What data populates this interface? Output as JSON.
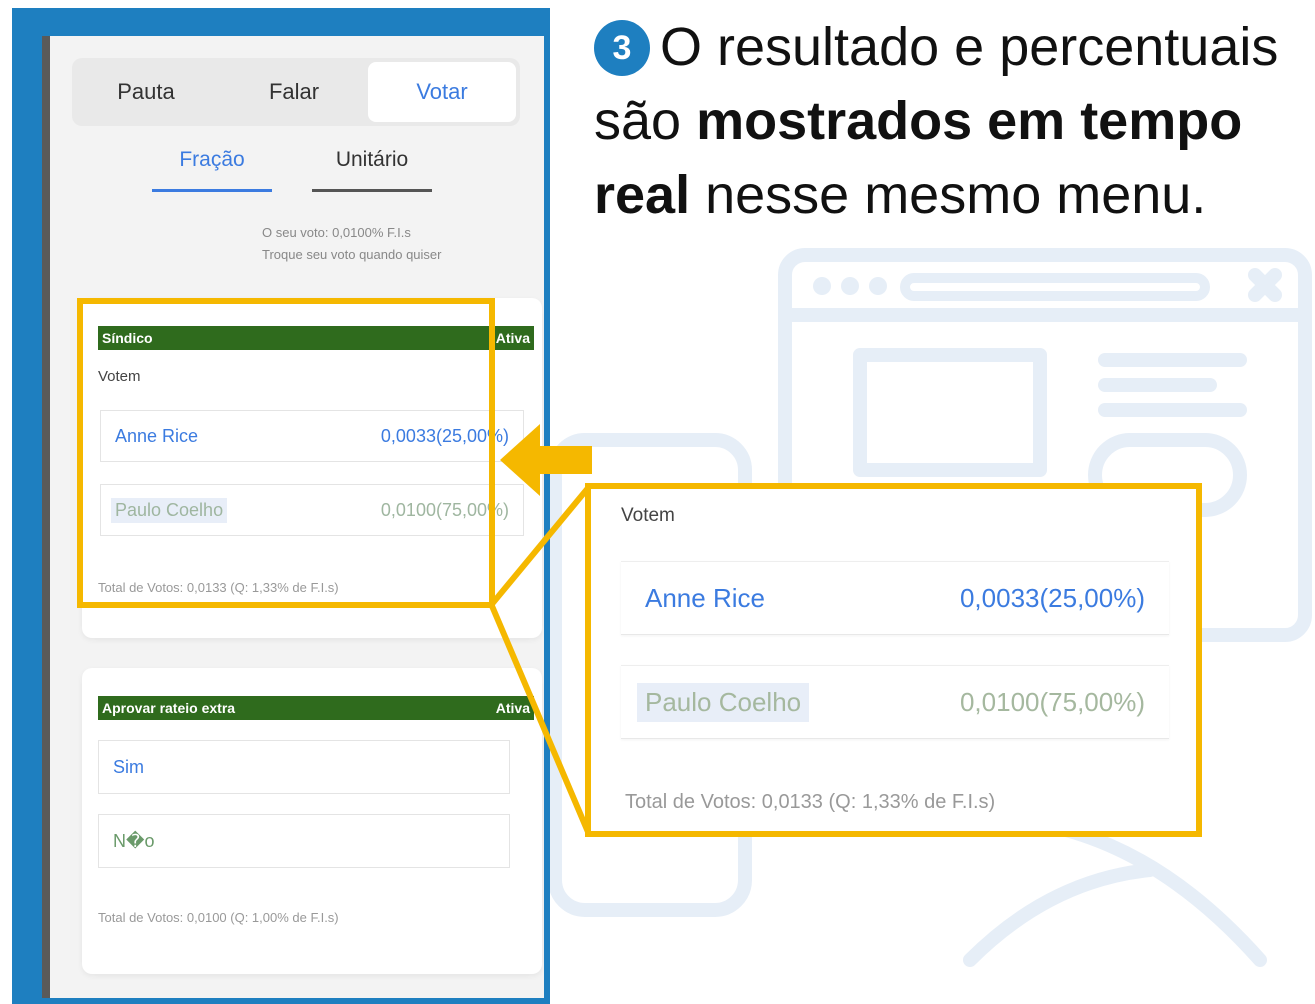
{
  "heading": {
    "step_number": "3",
    "part1": "O resultado e percentuais são ",
    "bold1": "mostrados em tempo real",
    "part2": " nesse mesmo menu."
  },
  "phone": {
    "tabs": [
      "Pauta",
      "Falar",
      "Votar"
    ],
    "active_tab": "Votar",
    "subtabs": [
      "Fração",
      "Unitário"
    ],
    "active_subtab": "Fração",
    "vote_info_line1": "O seu voto: 0,0100% F.I.s",
    "vote_info_line2": "Troque seu voto quando quiser",
    "card1": {
      "title": "Síndico",
      "status": "Ativa",
      "label": "Votem",
      "options": [
        {
          "name": "Anne Rice",
          "value": "0,0033(25,00%)"
        },
        {
          "name": "Paulo Coelho",
          "value": "0,0100(75,00%)"
        }
      ],
      "total": "Total de Votos: 0,0133 (Q: 1,33% de F.I.s)"
    },
    "card2": {
      "title": "Aprovar rateio extra",
      "status": "Ativa",
      "options": [
        {
          "name": "Sim"
        },
        {
          "name": "N�o"
        }
      ],
      "total": "Total de Votos: 0,0100 (Q: 1,00% de F.I.s)"
    }
  },
  "zoom": {
    "label": "Votem",
    "options": [
      {
        "name": "Anne Rice",
        "value": "0,0033(25,00%)"
      },
      {
        "name": "Paulo Coelho",
        "value": "0,0100(75,00%)"
      }
    ],
    "total": "Total de Votos: 0,0133 (Q: 1,33% de F.I.s)"
  },
  "colors": {
    "frame_blue": "#1e7fc0",
    "highlight_yellow": "#f5b800",
    "status_green": "#2f6b1d",
    "link_blue": "#3b7be0"
  }
}
